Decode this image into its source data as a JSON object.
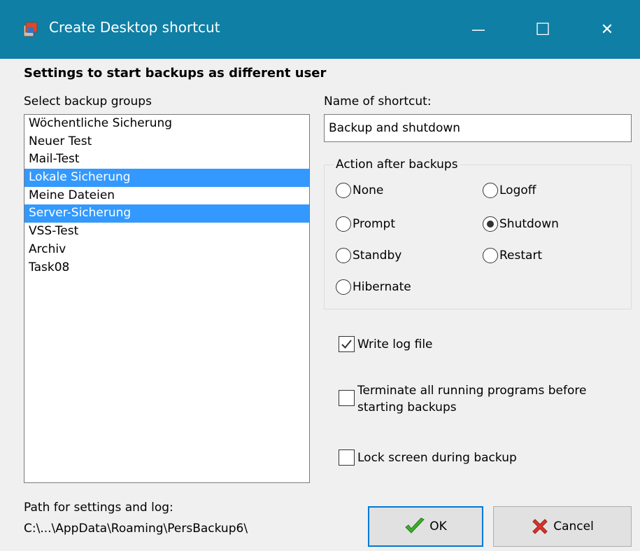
{
  "window": {
    "title": "Create Desktop shortcut",
    "minimize_glyph": "—",
    "maximize_glyph": "☐",
    "close_glyph": "✕"
  },
  "header": "Settings to start backups as different user",
  "groups": {
    "label": "Select backup groups",
    "items": [
      {
        "label": "Wöchentliche Sicherung",
        "selected": false
      },
      {
        "label": "Neuer Test",
        "selected": false
      },
      {
        "label": "Mail-Test",
        "selected": false
      },
      {
        "label": "Lokale Sicherung",
        "selected": true
      },
      {
        "label": "Meine Dateien",
        "selected": false
      },
      {
        "label": "Server-Sicherung",
        "selected": true
      },
      {
        "label": "VSS-Test",
        "selected": false
      },
      {
        "label": "Archiv",
        "selected": false
      },
      {
        "label": "Task08",
        "selected": false
      }
    ]
  },
  "shortcut": {
    "label": "Name of shortcut:",
    "value": "Backup and shutdown"
  },
  "action": {
    "legend": "Action after backups",
    "options": {
      "none": "None",
      "logoff": "Logoff",
      "prompt": "Prompt",
      "shutdown": "Shutdown",
      "standby": "Standby",
      "restart": "Restart",
      "hibernate": "Hibernate"
    },
    "selected": "shutdown"
  },
  "options": {
    "write_log": {
      "label": "Write log file",
      "checked": true
    },
    "terminate": {
      "line1": "Terminate all running programs before",
      "line2": "starting backups",
      "checked": false
    },
    "lock_screen": {
      "label": "Lock screen during backup",
      "checked": false
    }
  },
  "path": {
    "label": "Path for settings and log:",
    "value": "C:\\...\\AppData\\Roaming\\PersBackup6\\"
  },
  "buttons": {
    "ok": "OK",
    "cancel": "Cancel"
  },
  "colors": {
    "titlebar": "#0f7fa5",
    "selection": "#3399ff",
    "ok_check": "#3fae2a",
    "cancel_x": "#d9342b"
  }
}
